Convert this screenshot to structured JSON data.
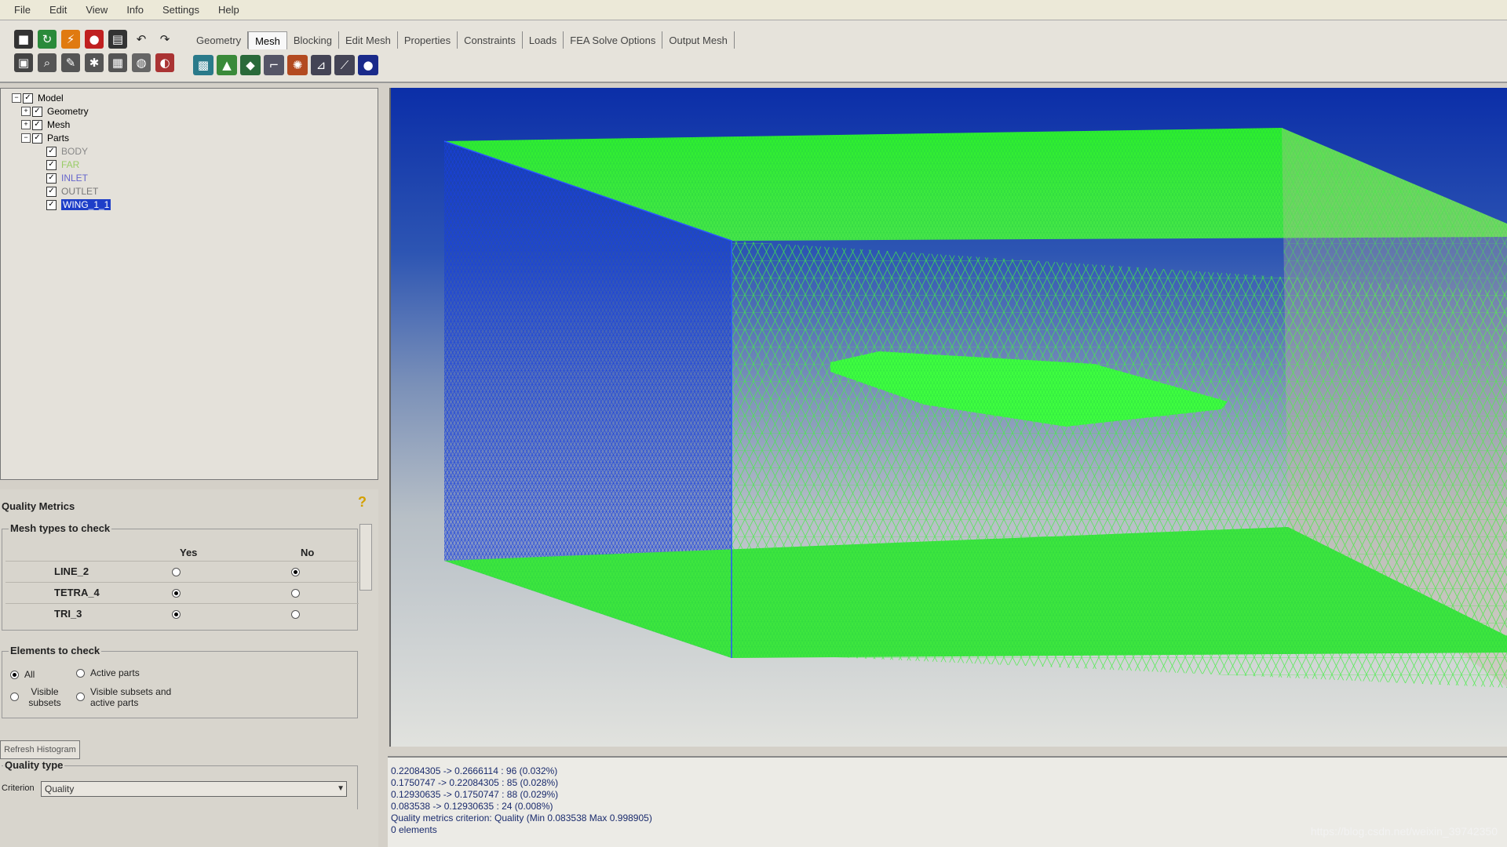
{
  "menu": [
    "File",
    "Edit",
    "View",
    "Info",
    "Settings",
    "Help"
  ],
  "tabs": [
    "Geometry",
    "Mesh",
    "Blocking",
    "Edit Mesh",
    "Properties",
    "Constraints",
    "Loads",
    "FEA Solve Options",
    "Output Mesh"
  ],
  "active_tab": "Mesh",
  "tree": {
    "root": "Model",
    "geometry": "Geometry",
    "mesh": "Mesh",
    "parts": "Parts",
    "part_items": [
      "BODY",
      "FAR",
      "INLET",
      "OUTLET",
      "WING_1_1"
    ],
    "part_colors": [
      "#888888",
      "#99cc66",
      "#6666cc",
      "#777777",
      "#ffffff"
    ],
    "selected": "WING_1_1"
  },
  "quality_metrics": {
    "title": "Quality Metrics",
    "mesh_types_title": "Mesh types to check",
    "col_yes": "Yes",
    "col_no": "No",
    "mesh_types": [
      {
        "name": "LINE_2",
        "value": "No"
      },
      {
        "name": "TETRA_4",
        "value": "Yes"
      },
      {
        "name": "TRI_3",
        "value": "Yes"
      }
    ],
    "elements_title": "Elements to check",
    "opt_all": "All",
    "opt_active": "Active parts",
    "opt_visible": "Visible subsets",
    "opt_visible_active": "Visible subsets and active parts",
    "selected_element_option": "All",
    "refresh_button": "Refresh Histogram",
    "quality_type_title": "Quality type",
    "criterion_label": "Criterion",
    "criterion_value": "Quality"
  },
  "console": [
    "0.22084305 -> 0.2666114 : 96 (0.032%)",
    "0.1750747 -> 0.22084305 : 85 (0.028%)",
    "0.12930635 -> 0.1750747 : 88 (0.029%)",
    "0.083538 -> 0.12930635 : 24 (0.008%)",
    "Quality metrics criterion: Quality (Min 0.083538 Max 0.998905)",
    "0 elements"
  ],
  "watermark": "https://blog.csdn.net/weixin_39742350",
  "colors": {
    "mesh_green": "#33ff33",
    "selection_blue": "#1e3ec8",
    "viewport_top": "#0b2ea8"
  }
}
